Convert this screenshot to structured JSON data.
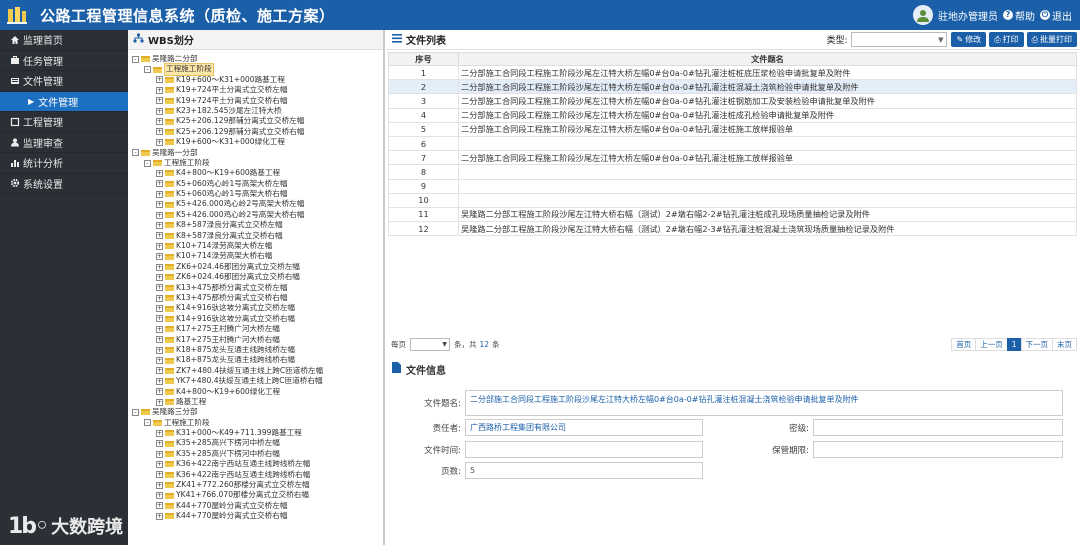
{
  "header": {
    "title": "公路工程管理信息系统（质检、施工方案）",
    "user": "驻地办管理员",
    "help": "帮助",
    "logout": "退出"
  },
  "sidebar": {
    "items": [
      {
        "label": "监理首页",
        "icon": "home-icon"
      },
      {
        "label": "任务管理",
        "icon": "briefcase-icon"
      },
      {
        "label": "文件管理",
        "icon": "folder-icon"
      },
      {
        "label": "文件管理",
        "icon": "caret-right-icon"
      },
      {
        "label": "工程管理",
        "icon": "square-icon"
      },
      {
        "label": "监理审查",
        "icon": "user-icon"
      },
      {
        "label": "统计分析",
        "icon": "bar-chart-icon"
      },
      {
        "label": "系统设置",
        "icon": "gear-icon"
      }
    ],
    "brand": "大数跨境"
  },
  "wbs": {
    "title": "WBS划分",
    "tree": [
      {
        "label": "吴隆路二分部",
        "level": 0,
        "toggle": "-"
      },
      {
        "label": "工程施工阶段",
        "level": 1,
        "toggle": "-",
        "selected": true
      },
      {
        "label": "K19+600～K31+000路基工程",
        "level": 2,
        "toggle": "+"
      },
      {
        "label": "K19+724平土分离式立交桥左幅",
        "level": 2,
        "toggle": "+"
      },
      {
        "label": "K19+724平土分离式立交桥右幅",
        "level": 2,
        "toggle": "+"
      },
      {
        "label": "K23+182.545沙尾左江特大桥",
        "level": 2,
        "toggle": "+"
      },
      {
        "label": "K25+206.129那辅分离式立交桥左幅",
        "level": 2,
        "toggle": "+"
      },
      {
        "label": "K25+206.129那辅分离式立交桥右幅",
        "level": 2,
        "toggle": "+"
      },
      {
        "label": "K19+600～K31+000绿化工程",
        "level": 2,
        "toggle": "+"
      },
      {
        "label": "吴隆路一分部",
        "level": 0,
        "toggle": "-"
      },
      {
        "label": "工程施工阶段",
        "level": 1,
        "toggle": "-"
      },
      {
        "label": "K4+800～K19+600路基工程",
        "level": 2,
        "toggle": "+"
      },
      {
        "label": "K5+060鸡心岭1号高架大桥左幅",
        "level": 2,
        "toggle": "+"
      },
      {
        "label": "K5+060鸡心岭1号高架大桥右幅",
        "level": 2,
        "toggle": "+"
      },
      {
        "label": "K5+426.000鸡心岭2号高架大桥左幅",
        "level": 2,
        "toggle": "+"
      },
      {
        "label": "K5+426.000鸡心岭2号高架大桥右幅",
        "level": 2,
        "toggle": "+"
      },
      {
        "label": "K8+587渌良分离式立交桥左幅",
        "level": 2,
        "toggle": "+"
      },
      {
        "label": "K8+587渌良分离式立交桥右幅",
        "level": 2,
        "toggle": "+"
      },
      {
        "label": "K10+714渌劳高架大桥左幅",
        "level": 2,
        "toggle": "+"
      },
      {
        "label": "K10+714渌劳高架大桥右幅",
        "level": 2,
        "toggle": "+"
      },
      {
        "label": "ZK6+024.46那团分离式立交桥左幅",
        "level": 2,
        "toggle": "+"
      },
      {
        "label": "ZK6+024.46那团分离式立交桥右幅",
        "level": 2,
        "toggle": "+"
      },
      {
        "label": "K13+475那桥分离式立交桥左幅",
        "level": 2,
        "toggle": "+"
      },
      {
        "label": "K13+475那桥分离式立交桥右幅",
        "level": 2,
        "toggle": "+"
      },
      {
        "label": "K14+916驮这坡分离式立交桥左幅",
        "level": 2,
        "toggle": "+"
      },
      {
        "label": "K14+916驮这坡分离式立交桥右幅",
        "level": 2,
        "toggle": "+"
      },
      {
        "label": "K17+275王村腾广河大桥左幅",
        "level": 2,
        "toggle": "+"
      },
      {
        "label": "K17+275王村腾广河大桥右幅",
        "level": 2,
        "toggle": "+"
      },
      {
        "label": "K18+875龙头互通主线跨线桥左幅",
        "level": 2,
        "toggle": "+"
      },
      {
        "label": "K18+875龙头互通主线跨线桥右幅",
        "level": 2,
        "toggle": "+"
      },
      {
        "label": "ZK7+480.4扶绥互通主线上跨C匝道桥左幅",
        "level": 2,
        "toggle": "+"
      },
      {
        "label": "YK7+480.4扶绥互通主线上跨C匝道桥右幅",
        "level": 2,
        "toggle": "+"
      },
      {
        "label": "K4+800～K19+600绿化工程",
        "level": 2,
        "toggle": "+"
      },
      {
        "label": "路基工程",
        "level": 2,
        "toggle": "+"
      },
      {
        "label": "吴隆路三分部",
        "level": 0,
        "toggle": "-"
      },
      {
        "label": "工程施工阶段",
        "level": 1,
        "toggle": "-"
      },
      {
        "label": "K31+000～K49+711.399路基工程",
        "level": 2,
        "toggle": "+"
      },
      {
        "label": "K35+285高兴下楞河中桥左幅",
        "level": 2,
        "toggle": "+"
      },
      {
        "label": "K35+285高兴下楞河中桥右幅",
        "level": 2,
        "toggle": "+"
      },
      {
        "label": "K36+422南宁西站互通主线跨线桥左幅",
        "level": 2,
        "toggle": "+"
      },
      {
        "label": "K36+422南宁西站互通主线跨线桥右幅",
        "level": 2,
        "toggle": "+"
      },
      {
        "label": "ZK41+772.260那楼分离式立交桥左幅",
        "level": 2,
        "toggle": "+"
      },
      {
        "label": "YK41+766.070那楼分离式立交桥右幅",
        "level": 2,
        "toggle": "+"
      },
      {
        "label": "K44+770屋岭分离式立交桥左幅",
        "level": 2,
        "toggle": "+"
      },
      {
        "label": "K44+770屋岭分离式立交桥右幅",
        "level": 2,
        "toggle": "+"
      }
    ]
  },
  "files": {
    "title": "文件列表",
    "type_label": "类型:",
    "type_value": "",
    "buttons": {
      "edit": "修改",
      "print": "打印",
      "batch_print": "批量打印"
    },
    "columns": [
      "序号",
      "文件题名"
    ],
    "rows": [
      {
        "no": "1",
        "title": "二分部施工合同段工程施工阶段沙尾左江特大桥左幅0#台0a-0#钻孔灌注桩桩底压浆检验申请批复单及附件"
      },
      {
        "no": "2",
        "title": "二分部施工合同段工程施工阶段沙尾左江特大桥左幅0#台0a-0#钻孔灌注桩混凝土浇筑检验申请批复单及附件",
        "highlight": true
      },
      {
        "no": "3",
        "title": "二分部施工合同段工程施工阶段沙尾左江特大桥左幅0#台0a-0#钻孔灌注桩钢筋加工及安装检验申请批复单及附件"
      },
      {
        "no": "4",
        "title": "二分部施工合同段工程施工阶段沙尾左江特大桥左幅0#台0a-0#钻孔灌注桩成孔检验申请批复单及附件"
      },
      {
        "no": "5",
        "title": "二分部施工合同段工程施工阶段沙尾左江特大桥左幅0#台0a-0#钻孔灌注桩施工放样报验单"
      },
      {
        "no": "6",
        "title": ""
      },
      {
        "no": "7",
        "title": "二分部施工合同段工程施工阶段沙尾左江特大桥左幅0#台0a-0#钻孔灌注桩施工放样报验单"
      },
      {
        "no": "8",
        "title": ""
      },
      {
        "no": "9",
        "title": ""
      },
      {
        "no": "10",
        "title": ""
      },
      {
        "no": "11",
        "title": "吴隆路二分部工程施工阶段沙尾左江特大桥右幅（测试）2#墩右幅2-2#钻孔灌注桩成孔现场质量抽检记录及附件"
      },
      {
        "no": "12",
        "title": "吴隆路二分部工程施工阶段沙尾左江特大桥右幅（测试）2#墩右幅2-3#钻孔灌注桩混凝土浇筑现场质量抽检记录及附件"
      }
    ],
    "pager": {
      "per_page": "每页",
      "per_page_value": "",
      "total_prefix": "条，共",
      "total": "12",
      "total_suffix": "条",
      "first": "首页",
      "prev": "上一页",
      "current": "1",
      "next": "下一页",
      "last": "末页"
    }
  },
  "file_info": {
    "title": "文件信息",
    "name_label": "文件题名:",
    "name_value": "二分部施工合同段工程施工阶段沙尾左江特大桥左幅0#台0a-0#钻孔灌注桩混凝土浇筑检验申请批复单及附件",
    "owner_label": "责任者:",
    "owner_value": "广西路桥工程集团有限公司",
    "secret_label": "密级:",
    "secret_value": "",
    "time_label": "文件时间:",
    "time_value": "",
    "retention_label": "保管期限:",
    "retention_value": "",
    "pages_label": "页数:",
    "pages_value": "5"
  }
}
